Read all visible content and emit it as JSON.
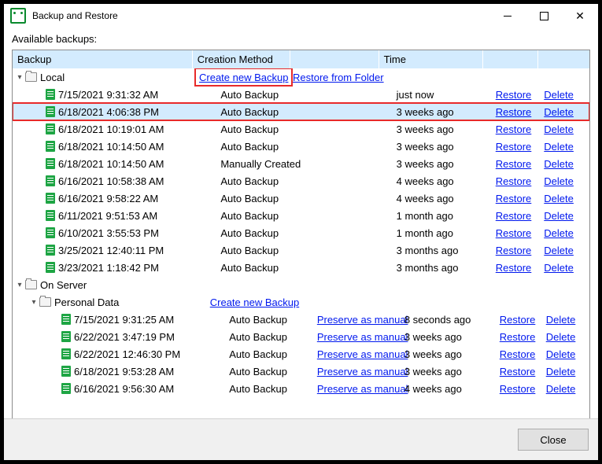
{
  "window": {
    "title": "Backup and Restore",
    "sub_label": "Available backups:"
  },
  "columns": {
    "backup": "Backup",
    "method": "Creation Method",
    "preserve": "",
    "time": "Time",
    "restore": "",
    "delete": ""
  },
  "actions": {
    "create": "Create new Backup",
    "restore_folder": "Restore from Folder",
    "restore": "Restore",
    "delete": "Delete",
    "preserve": "Preserve as manual",
    "close": "Close"
  },
  "groups": {
    "local": {
      "label": "Local",
      "rows": [
        {
          "ts": "7/15/2021 9:31:32 AM",
          "method": "Auto Backup",
          "time": "just now"
        },
        {
          "ts": "6/18/2021 4:06:38 PM",
          "method": "Auto Backup",
          "time": "3 weeks ago",
          "highlight": true
        },
        {
          "ts": "6/18/2021 10:19:01 AM",
          "method": "Auto Backup",
          "time": "3 weeks ago"
        },
        {
          "ts": "6/18/2021 10:14:50 AM",
          "method": "Auto Backup",
          "time": "3 weeks ago"
        },
        {
          "ts": "6/18/2021 10:14:50 AM",
          "method": "Manually Created",
          "time": "3 weeks ago"
        },
        {
          "ts": "6/16/2021 10:58:38 AM",
          "method": "Auto Backup",
          "time": "4 weeks ago"
        },
        {
          "ts": "6/16/2021 9:58:22 AM",
          "method": "Auto Backup",
          "time": "4 weeks ago"
        },
        {
          "ts": "6/11/2021 9:51:53 AM",
          "method": "Auto Backup",
          "time": "1 month ago"
        },
        {
          "ts": "6/10/2021 3:55:53 PM",
          "method": "Auto Backup",
          "time": "1 month ago"
        },
        {
          "ts": "3/25/2021 12:40:11 PM",
          "method": "Auto Backup",
          "time": "3 months ago"
        },
        {
          "ts": "3/23/2021 1:18:42 PM",
          "method": "Auto Backup",
          "time": "3 months ago"
        }
      ]
    },
    "server": {
      "label": "On Server",
      "personal": {
        "label": "Personal Data",
        "rows": [
          {
            "ts": "7/15/2021 9:31:25 AM",
            "method": "Auto Backup",
            "time": "8 seconds ago"
          },
          {
            "ts": "6/22/2021 3:47:19 PM",
            "method": "Auto Backup",
            "time": "3 weeks ago"
          },
          {
            "ts": "6/22/2021 12:46:30 PM",
            "method": "Auto Backup",
            "time": "3 weeks ago"
          },
          {
            "ts": "6/18/2021 9:53:28 AM",
            "method": "Auto Backup",
            "time": "3 weeks ago"
          },
          {
            "ts": "6/16/2021 9:56:30 AM",
            "method": "Auto Backup",
            "time": "4 weeks ago"
          }
        ]
      }
    }
  }
}
